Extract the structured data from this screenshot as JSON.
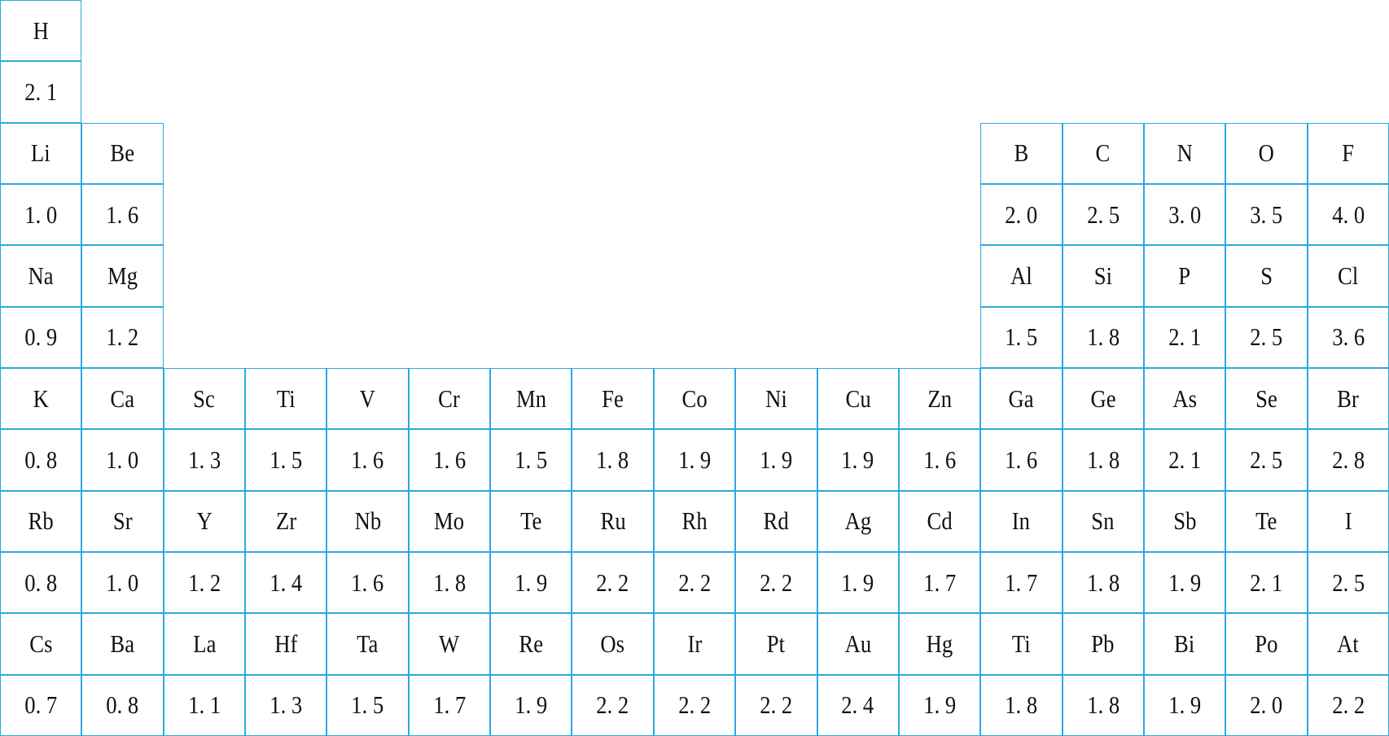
{
  "border_color": "#2aa9e0",
  "periods": [
    [
      {
        "symbol": "H",
        "value": "2. 1"
      },
      null,
      null,
      null,
      null,
      null,
      null,
      null,
      null,
      null,
      null,
      null,
      null,
      null,
      null,
      null,
      null
    ],
    [
      {
        "symbol": "Li",
        "value": "1. 0"
      },
      {
        "symbol": "Be",
        "value": "1. 6"
      },
      null,
      null,
      null,
      null,
      null,
      null,
      null,
      null,
      null,
      null,
      {
        "symbol": "B",
        "value": "2. 0"
      },
      {
        "symbol": "C",
        "value": "2. 5"
      },
      {
        "symbol": "N",
        "value": "3. 0"
      },
      {
        "symbol": "O",
        "value": "3. 5"
      },
      {
        "symbol": "F",
        "value": "4. 0"
      }
    ],
    [
      {
        "symbol": "Na",
        "value": "0. 9"
      },
      {
        "symbol": "Mg",
        "value": "1. 2"
      },
      null,
      null,
      null,
      null,
      null,
      null,
      null,
      null,
      null,
      null,
      {
        "symbol": "Al",
        "value": "1. 5"
      },
      {
        "symbol": "Si",
        "value": "1. 8"
      },
      {
        "symbol": "P",
        "value": "2. 1"
      },
      {
        "symbol": "S",
        "value": "2. 5"
      },
      {
        "symbol": "Cl",
        "value": "3. 6"
      }
    ],
    [
      {
        "symbol": "K",
        "value": "0. 8"
      },
      {
        "symbol": "Ca",
        "value": "1. 0"
      },
      {
        "symbol": "Sc",
        "value": "1. 3"
      },
      {
        "symbol": "Ti",
        "value": "1. 5"
      },
      {
        "symbol": "V",
        "value": "1. 6"
      },
      {
        "symbol": "Cr",
        "value": "1. 6"
      },
      {
        "symbol": "Mn",
        "value": "1. 5"
      },
      {
        "symbol": "Fe",
        "value": "1. 8"
      },
      {
        "symbol": "Co",
        "value": "1. 9"
      },
      {
        "symbol": "Ni",
        "value": "1. 9"
      },
      {
        "symbol": "Cu",
        "value": "1. 9"
      },
      {
        "symbol": "Zn",
        "value": "1. 6"
      },
      {
        "symbol": "Ga",
        "value": "1. 6"
      },
      {
        "symbol": "Ge",
        "value": "1. 8"
      },
      {
        "symbol": "As",
        "value": "2. 1"
      },
      {
        "symbol": "Se",
        "value": "2. 5"
      },
      {
        "symbol": "Br",
        "value": "2. 8"
      }
    ],
    [
      {
        "symbol": "Rb",
        "value": "0. 8"
      },
      {
        "symbol": "Sr",
        "value": "1. 0"
      },
      {
        "symbol": "Y",
        "value": "1. 2"
      },
      {
        "symbol": "Zr",
        "value": "1. 4"
      },
      {
        "symbol": "Nb",
        "value": "1. 6"
      },
      {
        "symbol": "Mo",
        "value": "1. 8"
      },
      {
        "symbol": "Te",
        "value": "1. 9"
      },
      {
        "symbol": "Ru",
        "value": "2. 2"
      },
      {
        "symbol": "Rh",
        "value": "2. 2"
      },
      {
        "symbol": "Rd",
        "value": "2. 2"
      },
      {
        "symbol": "Ag",
        "value": "1. 9"
      },
      {
        "symbol": "Cd",
        "value": "1. 7"
      },
      {
        "symbol": "In",
        "value": "1. 7"
      },
      {
        "symbol": "Sn",
        "value": "1. 8"
      },
      {
        "symbol": "Sb",
        "value": "1. 9"
      },
      {
        "symbol": "Te",
        "value": "2. 1"
      },
      {
        "symbol": "I",
        "value": "2. 5"
      }
    ],
    [
      {
        "symbol": "Cs",
        "value": "0. 7"
      },
      {
        "symbol": "Ba",
        "value": "0. 8"
      },
      {
        "symbol": "La",
        "value": "1. 1"
      },
      {
        "symbol": "Hf",
        "value": "1. 3"
      },
      {
        "symbol": "Ta",
        "value": "1. 5"
      },
      {
        "symbol": "W",
        "value": "1. 7"
      },
      {
        "symbol": "Re",
        "value": "1. 9"
      },
      {
        "symbol": "Os",
        "value": "2. 2"
      },
      {
        "symbol": "Ir",
        "value": "2. 2"
      },
      {
        "symbol": "Pt",
        "value": "2. 2"
      },
      {
        "symbol": "Au",
        "value": "2. 4"
      },
      {
        "symbol": "Hg",
        "value": "1. 9"
      },
      {
        "symbol": "Ti",
        "value": "1. 8"
      },
      {
        "symbol": "Pb",
        "value": "1. 8"
      },
      {
        "symbol": "Bi",
        "value": "1. 9"
      },
      {
        "symbol": "Po",
        "value": "2. 0"
      },
      {
        "symbol": "At",
        "value": "2. 2"
      }
    ]
  ]
}
